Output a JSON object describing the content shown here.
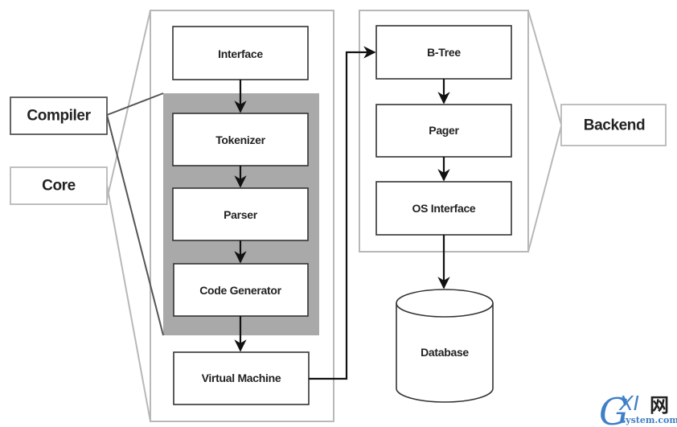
{
  "diagram": {
    "title": "",
    "left_labels": {
      "compiler": "Compiler",
      "core": "Core"
    },
    "core_components": [
      {
        "id": "interface",
        "label": "Interface"
      },
      {
        "id": "tokenizer",
        "label": "Tokenizer"
      },
      {
        "id": "parser",
        "label": "Parser"
      },
      {
        "id": "code_generator",
        "label": "Code Generator"
      },
      {
        "id": "virtual_machine",
        "label": "Virtual Machine"
      }
    ],
    "compiler_group": [
      "Tokenizer",
      "Parser",
      "Code Generator"
    ],
    "backend_components": [
      {
        "id": "btree",
        "label": "B-Tree"
      },
      {
        "id": "pager",
        "label": "Pager"
      },
      {
        "id": "os_interface",
        "label": "OS Interface"
      }
    ],
    "backend_label": "Backend",
    "storage": {
      "label": "Database"
    },
    "edges": [
      {
        "from": "Interface",
        "to": "Tokenizer"
      },
      {
        "from": "Tokenizer",
        "to": "Parser"
      },
      {
        "from": "Parser",
        "to": "Code Generator"
      },
      {
        "from": "Code Generator",
        "to": "Virtual Machine"
      },
      {
        "from": "Virtual Machine",
        "to": "B-Tree"
      },
      {
        "from": "B-Tree",
        "to": "Pager"
      },
      {
        "from": "Pager",
        "to": "OS Interface"
      },
      {
        "from": "OS Interface",
        "to": "Database"
      }
    ],
    "colors": {
      "compiler_group_fill": "#a9a9a9",
      "group_border": "#b8b8b8",
      "box_border": "#333333",
      "arrow": "#111111"
    }
  },
  "watermark": {
    "g": "G",
    "xi": "XI",
    "cn": "网",
    "domain": "system.com"
  }
}
